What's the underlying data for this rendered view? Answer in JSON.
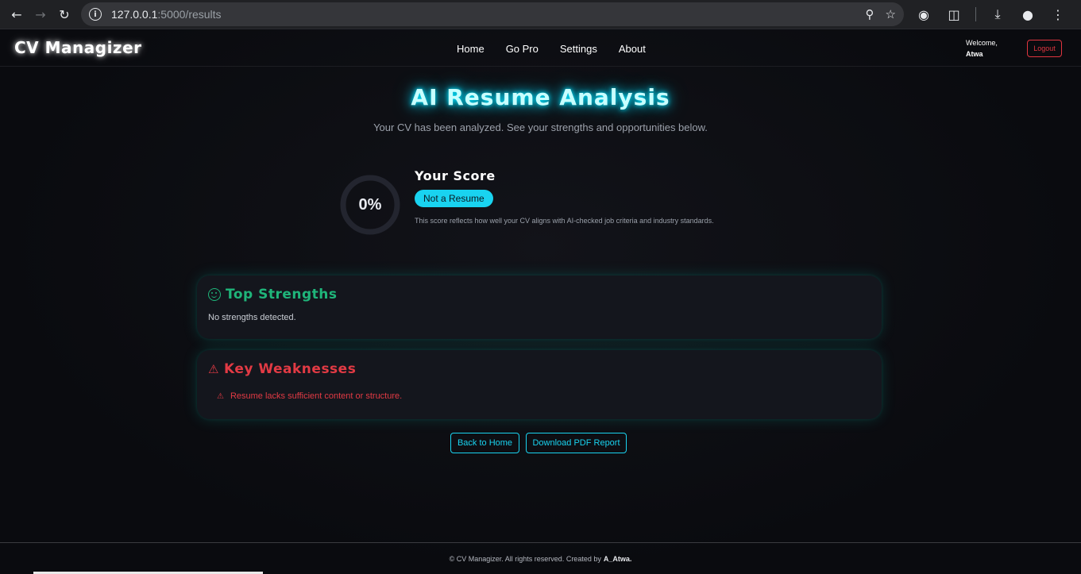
{
  "browser": {
    "url_host": "127.0.0.1",
    "url_path": ":5000/results"
  },
  "nav": {
    "logo": "CV Managizer",
    "links": [
      "Home",
      "Go Pro",
      "Settings",
      "About"
    ],
    "welcome_label": "Welcome,",
    "username": "Atwa",
    "logout": "Logout"
  },
  "hero": {
    "title": "AI Resume Analysis",
    "subtitle": "Your CV has been analyzed. See your strengths and opportunities below."
  },
  "score": {
    "value": "0%",
    "title": "Your Score",
    "badge": "Not a Resume",
    "description": "This score reflects how well your CV aligns with AI-checked job criteria and industry standards.",
    "fraction": 0
  },
  "strengths": {
    "title": "Top Strengths",
    "empty": "No strengths detected."
  },
  "weaknesses": {
    "title": "Key Weaknesses",
    "items": [
      "Resume lacks sufficient content or structure."
    ]
  },
  "actions": {
    "back": "Back to Home",
    "download": "Download PDF Report"
  },
  "footer": {
    "text": "© CV Managizer. All rights reserved. Created by",
    "author": "A_Atwa."
  },
  "colors": {
    "accent": "#19d3f0",
    "strength": "#1fb57a",
    "weakness": "#e23a44"
  }
}
